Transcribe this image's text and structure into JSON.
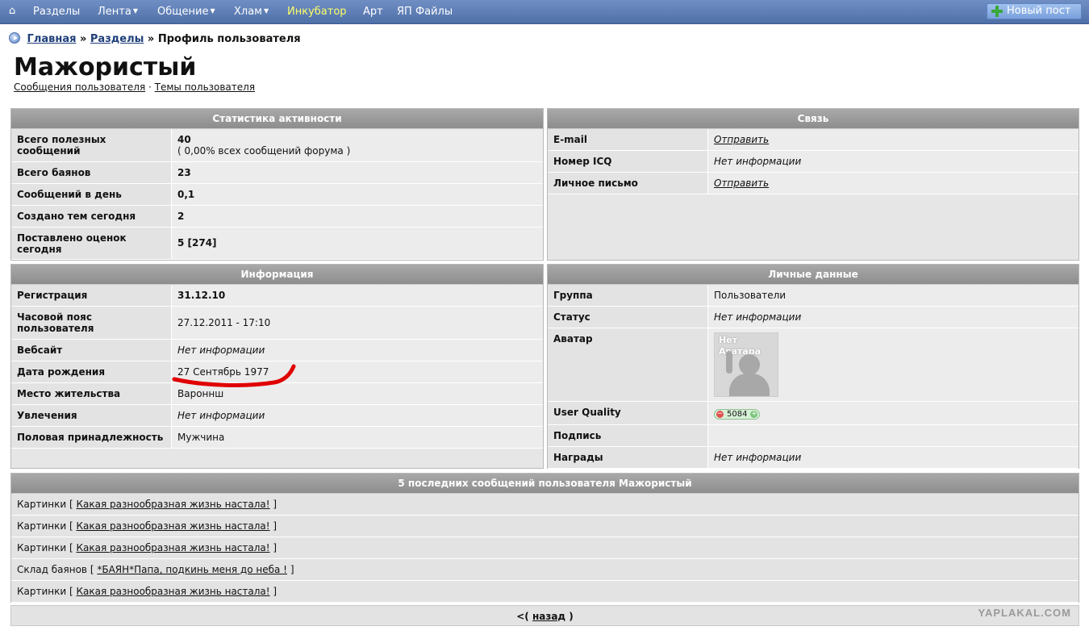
{
  "nav": {
    "home_icon": "home-icon",
    "items": [
      {
        "label": "Разделы",
        "dropdown": false,
        "highlight": false
      },
      {
        "label": "Лента",
        "dropdown": true,
        "highlight": false
      },
      {
        "label": "Общение",
        "dropdown": true,
        "highlight": false
      },
      {
        "label": "Хлам",
        "dropdown": true,
        "highlight": false
      },
      {
        "label": "Инкубатор",
        "dropdown": false,
        "highlight": true
      },
      {
        "label": "Арт",
        "dropdown": false,
        "highlight": false
      },
      {
        "label": "ЯП Файлы",
        "dropdown": false,
        "highlight": false
      }
    ],
    "new_post": "Новый пост"
  },
  "breadcrumb": {
    "home": "Главная",
    "sep": "»",
    "sections": "Разделы",
    "current": "Профиль пользователя"
  },
  "profile": {
    "username": "Мажористый",
    "messages_link": "Сообщения пользователя",
    "link_sep": "·",
    "topics_link": "Темы пользователя"
  },
  "stats": {
    "title": "Статистика активности",
    "rows": [
      {
        "label": "Всего полезных сообщений",
        "value": "40",
        "sub": "( 0,00% всех сообщений форума )"
      },
      {
        "label": "Всего баянов",
        "value": "23"
      },
      {
        "label": "Сообщений в день",
        "value": "0,1"
      },
      {
        "label": "Создано тем сегодня",
        "value": "2"
      },
      {
        "label": "Поставлено оценок сегодня",
        "value": "5 [274]"
      }
    ]
  },
  "contact": {
    "title": "Связь",
    "rows": [
      {
        "label": "E-mail",
        "value": "Отправить"
      },
      {
        "label": "Номер ICQ",
        "value": "Нет информации"
      },
      {
        "label": "Личное письмо",
        "value": "Отправить"
      }
    ]
  },
  "info": {
    "title": "Информация",
    "rows": [
      {
        "label": "Регистрация",
        "value": "31.12.10"
      },
      {
        "label": "Часовой пояс пользователя",
        "value": "27.12.2011 - 17:10"
      },
      {
        "label": "Вебсайт",
        "value": "Нет информации"
      },
      {
        "label": "Дата рождения",
        "value": "27 Сентябрь 1977"
      },
      {
        "label": "Место жительства",
        "value": "Вароннш"
      },
      {
        "label": "Увлечения",
        "value": "Нет информации"
      },
      {
        "label": "Половая принадлежность",
        "value": "Мужчина"
      }
    ]
  },
  "personal": {
    "title": "Личные данные",
    "rows": [
      {
        "label": "Группа",
        "value": "Пользователи"
      },
      {
        "label": "Статус",
        "value": "Нет информации"
      },
      {
        "label": "Аватар",
        "avatar_text": "Нет Аватара"
      },
      {
        "label": "User Quality",
        "value": "5084"
      },
      {
        "label": "Подпись",
        "value": ""
      },
      {
        "label": "Награды",
        "value": "Нет информации"
      }
    ]
  },
  "recent": {
    "title": "5 последних сообщений пользователя Мажористый",
    "items": [
      {
        "section": "Картинки",
        "topic": "Какая разнообразная жизнь настала!"
      },
      {
        "section": "Картинки",
        "topic": "Какая разнообразная жизнь настала!"
      },
      {
        "section": "Картинки",
        "topic": "Какая разнообразная жизнь настала!"
      },
      {
        "section": "Склад баянов",
        "topic": "*БАЯН*Папа, подкинь меня до неба !"
      },
      {
        "section": "Картинки",
        "topic": "Какая разнообразная жизнь настала!"
      }
    ],
    "open_bracket": "[",
    "close_bracket": "]"
  },
  "footer": {
    "back_prefix": "<(",
    "back_link": "назад",
    "back_suffix": ")"
  },
  "watermark": "YAPLAKAL.COM",
  "colors": {
    "nav_bg": "#5a7ab4",
    "highlight": "#ffff66",
    "panel_head": "#9a9a9a",
    "scribble": "#e00000"
  }
}
